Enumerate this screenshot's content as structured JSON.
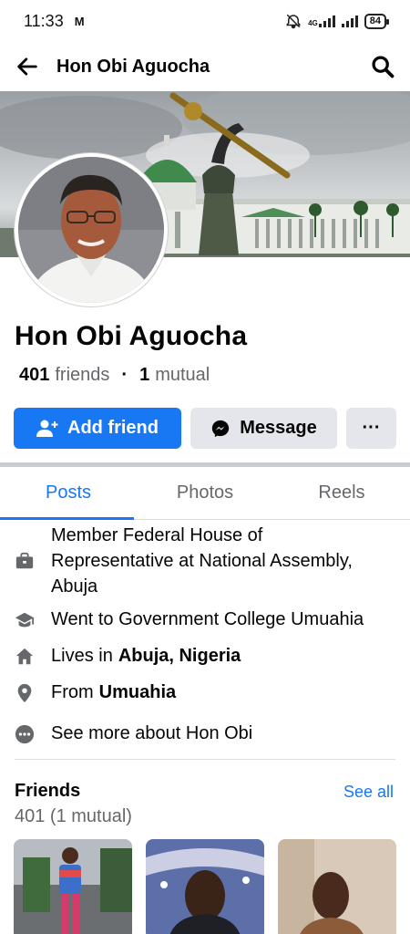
{
  "status": {
    "time": "11:33",
    "carrier_icon": "M",
    "network": "4G",
    "battery": "84"
  },
  "header": {
    "title": "Hon Obi Aguocha"
  },
  "profile": {
    "name": "Hon Obi Aguocha",
    "friends_count": "401",
    "friends_label": "friends",
    "mutual_count": "1",
    "mutual_label": "mutual"
  },
  "actions": {
    "add_friend": "Add friend",
    "message": "Message",
    "more": "···"
  },
  "tabs": [
    {
      "label": "Posts",
      "active": true
    },
    {
      "label": "Photos",
      "active": false
    },
    {
      "label": "Reels",
      "active": false
    }
  ],
  "intro": {
    "work": "Member Federal House of Representative at National Assembly, Abuja",
    "education": "Went to Government College Umuahia",
    "lives_prefix": "Lives in",
    "lives_place": "Abuja, Nigeria",
    "from_prefix": "From",
    "from_place": "Umuahia",
    "see_more": "See more about Hon Obi"
  },
  "friends": {
    "title": "Friends",
    "see_all": "See all",
    "count_text": "401 (1 mutual)"
  },
  "colors": {
    "accent": "#1877f2",
    "secondary_button": "#e4e6eb",
    "muted_text": "#65676b"
  }
}
